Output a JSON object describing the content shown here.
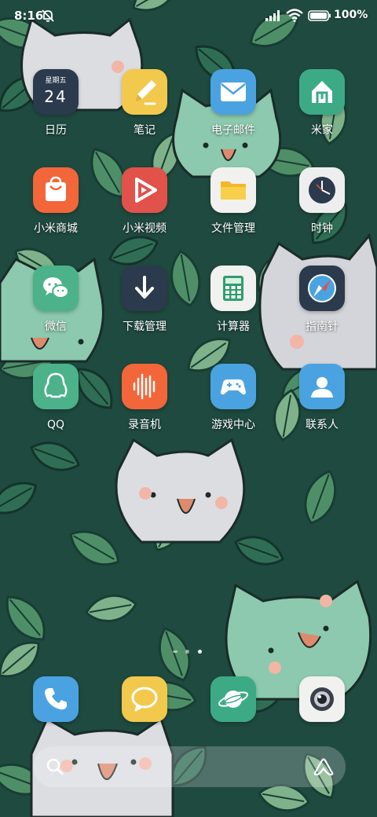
{
  "status_bar": {
    "time": "8:16",
    "battery": "100%",
    "icons": [
      "bell-muted-icon",
      "signal-icon",
      "wifi-icon",
      "battery-icon"
    ]
  },
  "apps": [
    {
      "label": "日历",
      "icon": "calendar-icon",
      "color": "#2b3a4d",
      "weekday": "星期五",
      "day": "24"
    },
    {
      "label": "笔记",
      "icon": "notes-icon",
      "color": "#f2c94c"
    },
    {
      "label": "电子邮件",
      "icon": "mail-icon",
      "color": "#4aa3e0"
    },
    {
      "label": "米家",
      "icon": "mi-home-icon",
      "color": "#3daa86"
    },
    {
      "label": "小米商城",
      "icon": "shopping-bag-icon",
      "color": "#f2663a"
    },
    {
      "label": "小米视频",
      "icon": "play-icon",
      "color": "#e0524a"
    },
    {
      "label": "文件管理",
      "icon": "folder-icon",
      "color": "#f1f1ef"
    },
    {
      "label": "时钟",
      "icon": "clock-icon",
      "color": "#eeeeee"
    },
    {
      "label": "微信",
      "icon": "wechat-icon",
      "color": "#4cb28a"
    },
    {
      "label": "下载管理",
      "icon": "download-icon",
      "color": "#2b3a4d"
    },
    {
      "label": "计算器",
      "icon": "calculator-icon",
      "color": "#f1f1ef"
    },
    {
      "label": "指南针",
      "icon": "compass-icon",
      "color": "#2b3a4d"
    },
    {
      "label": "QQ",
      "icon": "qq-penguin-icon",
      "color": "#4cb28a"
    },
    {
      "label": "录音机",
      "icon": "recorder-icon",
      "color": "#f2663a"
    },
    {
      "label": "游戏中心",
      "icon": "gamepad-icon",
      "color": "#4aa3e0"
    },
    {
      "label": "联系人",
      "icon": "contacts-icon",
      "color": "#4aa3e0"
    }
  ],
  "dock": [
    {
      "icon": "phone-icon",
      "color": "#4aa3e0"
    },
    {
      "icon": "message-icon",
      "color": "#f2c94c"
    },
    {
      "icon": "browser-planet-icon",
      "color": "#3daa86"
    },
    {
      "icon": "camera-icon",
      "color": "#f1f1ef"
    }
  ],
  "page_indicator": {
    "pages": 3,
    "active": 3
  },
  "search": {
    "icons": [
      "search-icon",
      "assistant-icon"
    ]
  }
}
